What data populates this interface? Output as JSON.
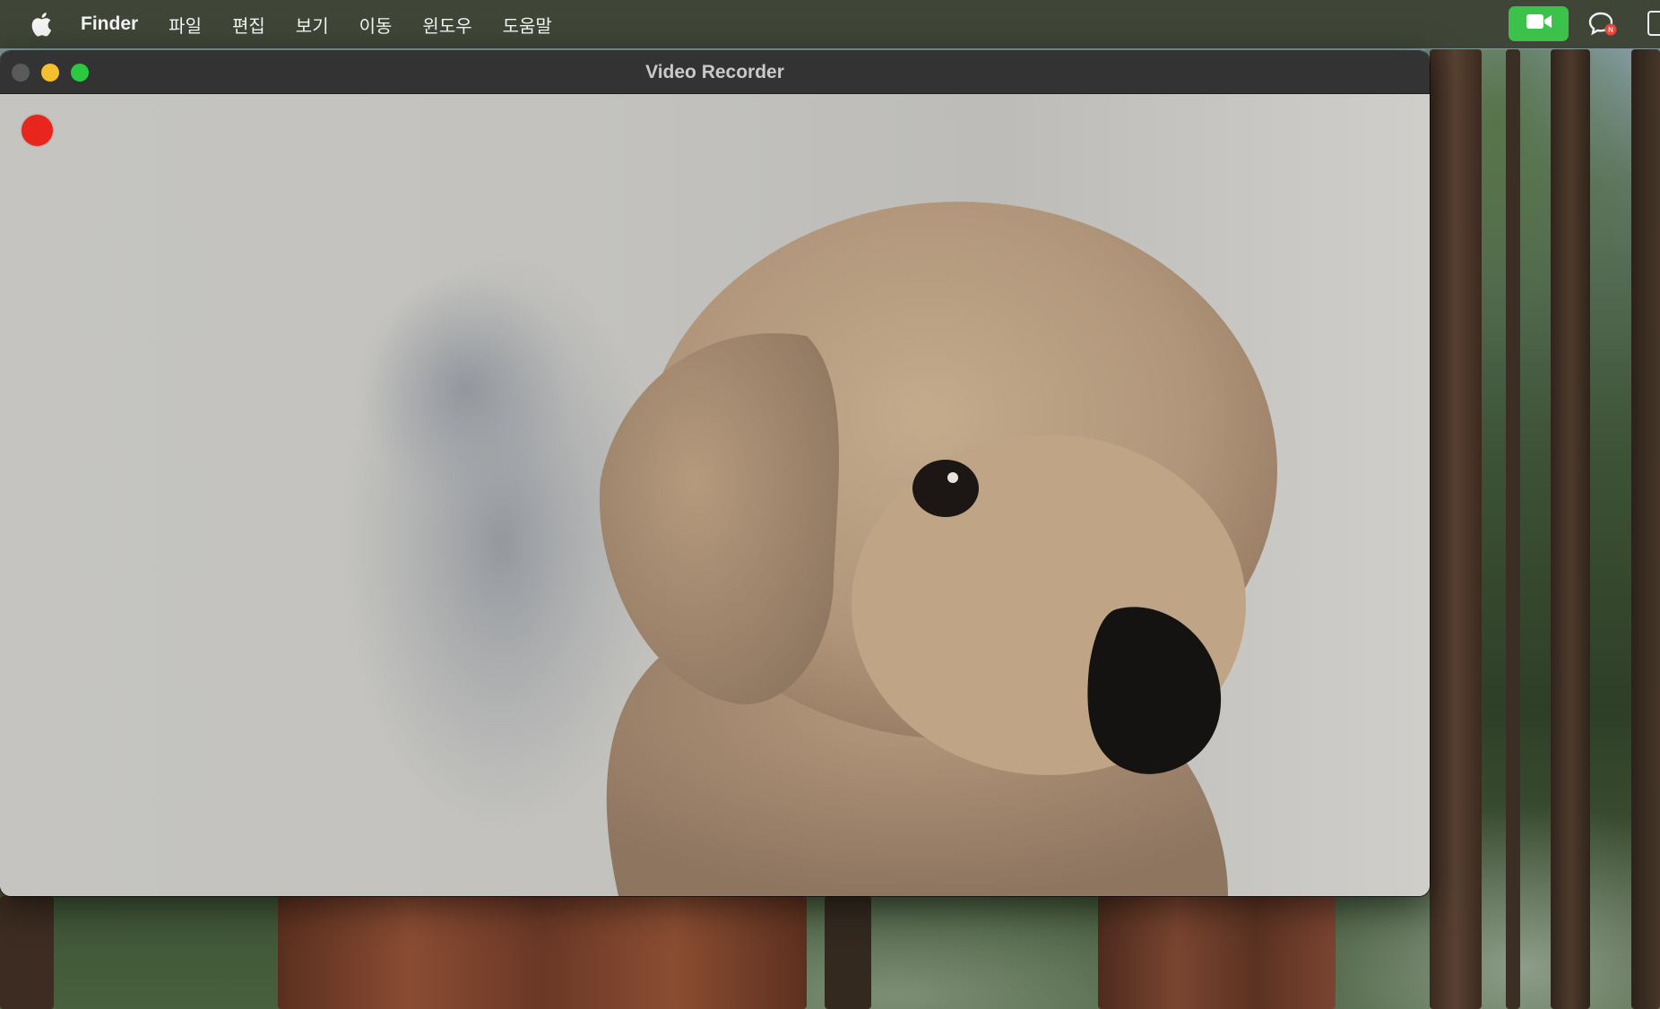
{
  "menubar": {
    "apple_icon": "apple-logo-icon",
    "app_name": "Finder",
    "items": [
      "파일",
      "편집",
      "보기",
      "이동",
      "윈도우",
      "도움말"
    ],
    "status_icons": [
      "video-camera-icon",
      "chat-bubble-icon",
      "window-icon"
    ],
    "camera_indicator_color": "#3cc24b"
  },
  "window": {
    "title": "Video Recorder",
    "traffic_lights": {
      "close_color": "#5a5a5a",
      "minimize_color": "#f5bf2e",
      "maximize_color": "#2ac940"
    },
    "recording_indicator_color": "#e8261d"
  }
}
